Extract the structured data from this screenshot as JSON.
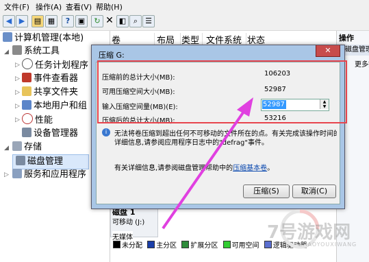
{
  "menu": {
    "file": "文件(F)",
    "action": "操作(A)",
    "view": "查看(V)",
    "help": "帮助(H)"
  },
  "toolbar_icons": [
    "back-icon",
    "forward-icon",
    "folder-icon",
    "properties-icon",
    "help-icon",
    "console-icon",
    "refresh-icon",
    "delete-icon",
    "disk-icon",
    "search-icon",
    "list-icon"
  ],
  "tree": {
    "root": "计算机管理(本地)",
    "system_tools": "系统工具",
    "task_scheduler": "任务计划程序",
    "event_viewer": "事件查看器",
    "shared_folders": "共享文件夹",
    "local_users": "本地用户和组",
    "performance": "性能",
    "device_manager": "设备管理器",
    "storage": "存储",
    "disk_management": "磁盘管理",
    "services_apps": "服务和应用程序"
  },
  "columns": [
    "卷",
    "布局",
    "类型",
    "文件系统",
    "状态"
  ],
  "actions": {
    "header": "操作",
    "item1": "磁盘管理",
    "item2": "更多操作"
  },
  "disk": {
    "name": "磁盘 1",
    "type": "可移动 (J:)",
    "media": "无媒体"
  },
  "legend": [
    "未分配",
    "主分区",
    "扩展分区",
    "可用空间",
    "逻辑驱动器"
  ],
  "legend_colors": [
    "#000000",
    "#1a3ea8",
    "#2e8b3a",
    "#32cd32",
    "#5b6fd0"
  ],
  "dialog": {
    "title": "压缩 G:",
    "close": "✕",
    "total_before_label": "压缩前的总计大小(MB):",
    "total_before_value": "106203",
    "available_label": "可用压缩空间大小(MB):",
    "available_value": "52987",
    "input_label": "输入压缩空间量(MB)(E):",
    "input_value": "52987",
    "total_after_label": "压缩后的总计大小(MB):",
    "total_after_value": "53216",
    "info_text_1": "无法将卷压缩到超出任何不可移动的文件所在的点。有关完成该操作时间的",
    "info_text_2": "详细信息,请参阅应用程序日志中的\"defrag\"事件。",
    "more_info": "有关详细信息,请参阅磁盘管理帮助中的",
    "more_info_link": "压缩基本卷",
    "more_info_end": "。",
    "shrink_button": "压缩(S)",
    "cancel_button": "取消(C)"
  },
  "watermark": {
    "main": "7号游戏网",
    "sub": "ZHAOYOUXIWANG"
  },
  "highlight_color": "#e8444d",
  "arrow_color": "#e040e0"
}
